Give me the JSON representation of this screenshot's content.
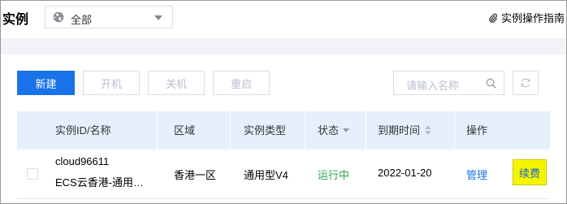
{
  "header": {
    "title": "实例",
    "region_icon": "globe-icon",
    "region_value": "全部",
    "guide_icon": "paperclip-icon",
    "guide_label": "实例操作指南"
  },
  "toolbar": {
    "create_label": "新建",
    "power_on_label": "开机",
    "power_off_label": "关机",
    "reboot_label": "重启",
    "search_placeholder": "请输入名称",
    "search_icon": "search-icon",
    "refresh_icon": "refresh-icon"
  },
  "table": {
    "columns": {
      "id_name": "实例ID/名称",
      "region": "区域",
      "type": "实例类型",
      "status": "状态",
      "expiry": "到期时间",
      "actions": "操作"
    },
    "rows": [
      {
        "id": "cloud96611",
        "name": "ECS云香港-通用…",
        "region": "香港一区",
        "type": "通用型V4",
        "status": "运行中",
        "expiry": "2022-01-20",
        "manage_label": "管理",
        "renew_label": "续费"
      }
    ]
  },
  "colors": {
    "primary": "#1a72e8",
    "header_bg": "#e6f0fd",
    "status_running": "#2aa34a",
    "highlight": "#f5f500"
  }
}
